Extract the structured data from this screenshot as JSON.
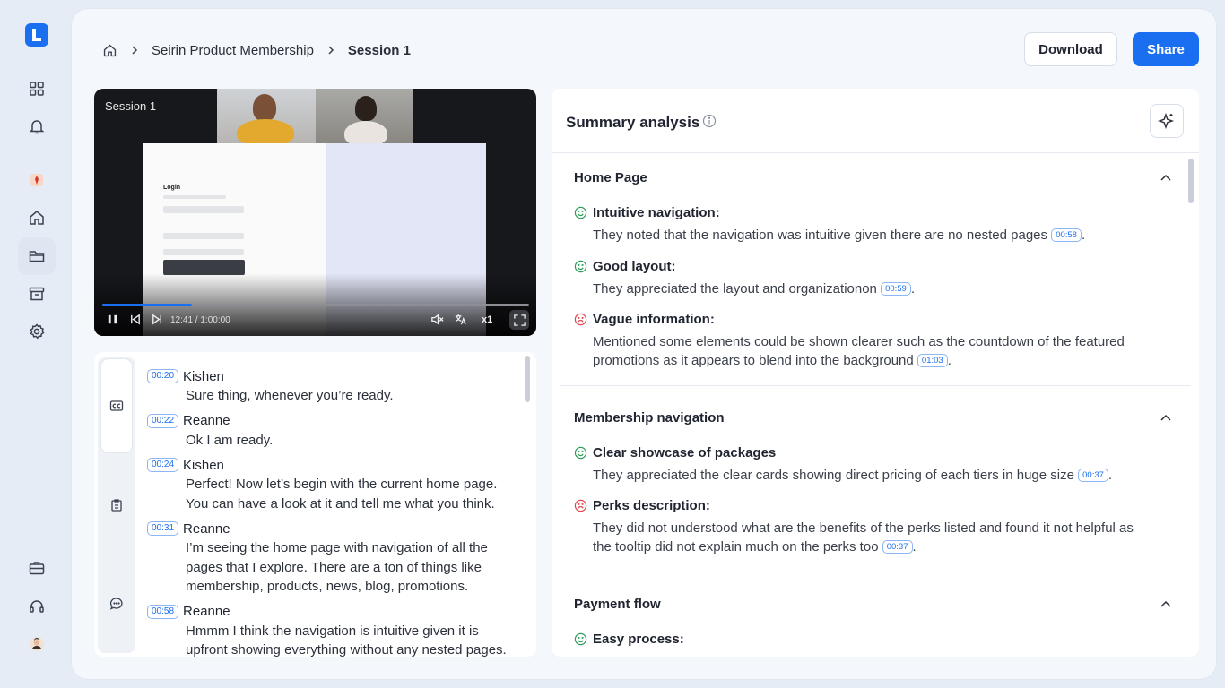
{
  "breadcrumb": {
    "project": "Seirin Product Membership",
    "current": "Session 1"
  },
  "actions": {
    "download": "Download",
    "share": "Share"
  },
  "colors": {
    "accent": "#1a6ff0",
    "positive": "#2e9e5a",
    "negative": "#e0484f"
  },
  "video": {
    "title": "Session 1",
    "time": "12:41 / 1:00:00",
    "speed": "x1",
    "progress_fraction": 0.21,
    "screen_title": "Login"
  },
  "transcript": {
    "entries": [
      {
        "ts": "00:20",
        "speaker": "Kishen",
        "text": "Sure thing, whenever you’re ready."
      },
      {
        "ts": "00:22",
        "speaker": "Reanne",
        "text": "Ok I am ready."
      },
      {
        "ts": "00:24",
        "speaker": "Kishen",
        "text": "Perfect! Now let’s begin with the current home page. You can have a look at it and tell me what you think."
      },
      {
        "ts": "00:31",
        "speaker": "Reanne",
        "text": "I’m seeing the home page with navigation of all the pages that I explore. There are a ton of things like membership, products, news, blog, promotions."
      },
      {
        "ts": "00:58",
        "speaker": "Reanne",
        "text": "Hmmm I think the navigation is intuitive given it is upfront showing everything without any nested pages."
      }
    ]
  },
  "summary": {
    "title": "Summary analysis",
    "sections": [
      {
        "title": "Home Page",
        "items": [
          {
            "sentiment": "positive",
            "heading": "Intuitive navigation:",
            "text": "They noted that the navigation was intuitive given there are no nested pages",
            "ts": "00:58"
          },
          {
            "sentiment": "positive",
            "heading": "Good layout:",
            "text": "They appreciated the layout and organizationon",
            "ts": "00:59"
          },
          {
            "sentiment": "negative",
            "heading": "Vague information:",
            "text": "Mentioned some elements could be shown clearer such as the countdown of the featured promotions as it appears to blend into the background",
            "ts": "01:03"
          }
        ]
      },
      {
        "title": "Membership navigation",
        "items": [
          {
            "sentiment": "positive",
            "heading": "Clear showcase of packages",
            "text": "They appreciated the clear cards showing direct pricing of each tiers in huge size",
            "ts": "00:37"
          },
          {
            "sentiment": "negative",
            "heading": "Perks description:",
            "text": "They did not understood what are the benefits of the perks listed and found it not helpful as the tooltip did not explain much on the perks too",
            "ts": "00:37"
          }
        ]
      },
      {
        "title": "Payment flow",
        "items": [
          {
            "sentiment": "positive",
            "heading": "Easy process:"
          }
        ]
      }
    ]
  }
}
